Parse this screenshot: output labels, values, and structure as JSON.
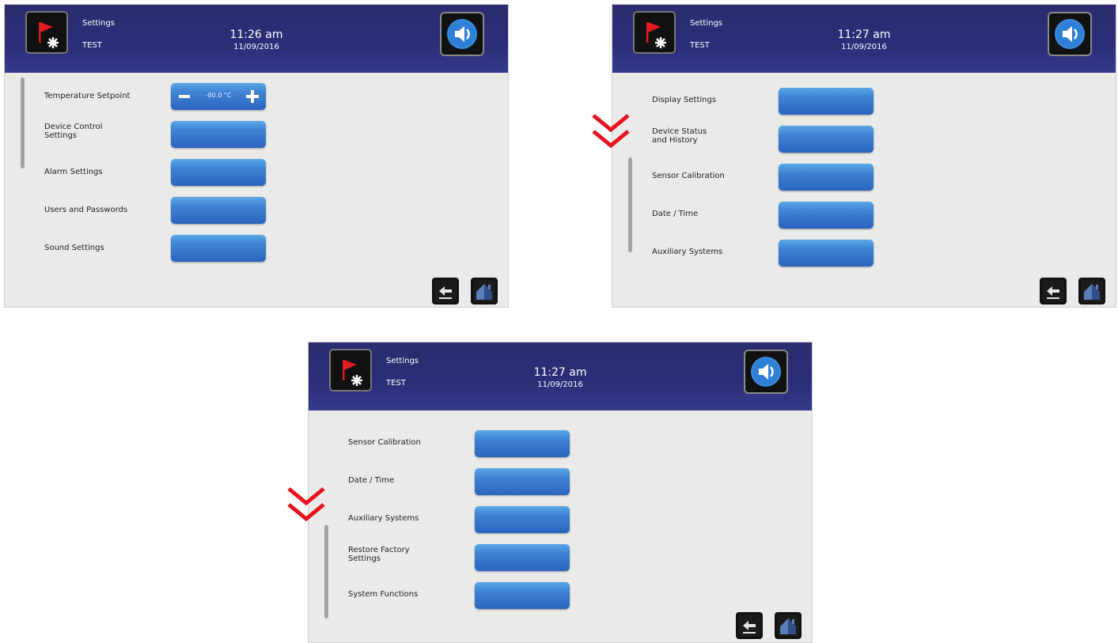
{
  "header": {
    "title": "Settings",
    "subtitle": "TEST",
    "date": "11/09/2016"
  },
  "screens": [
    {
      "time": "11:26 am",
      "setpoint": {
        "label": "Temperature Setpoint",
        "value": "-80.0 °C"
      },
      "items": [
        {
          "label": "Device Control\nSettings"
        },
        {
          "label": "Alarm Settings"
        },
        {
          "label": "Users and Passwords"
        },
        {
          "label": "Sound Settings"
        }
      ]
    },
    {
      "time": "11:27 am",
      "items": [
        {
          "label": "Display Settings"
        },
        {
          "label": "Device Status\nand History"
        },
        {
          "label": "Sensor Calibration"
        },
        {
          "label": "Date / Time"
        },
        {
          "label": "Auxiliary Systems"
        }
      ]
    },
    {
      "time": "11:27 am",
      "items": [
        {
          "label": "Sensor Calibration"
        },
        {
          "label": "Date / Time"
        },
        {
          "label": "Auxiliary Systems"
        },
        {
          "label": "Restore Factory\nSettings"
        },
        {
          "label": "System Functions"
        }
      ]
    }
  ],
  "icons": {
    "alarm": "alarm-flag-icon",
    "sound": "speaker-icon",
    "back": "back-arrow-icon",
    "home": "home-icon",
    "scroll_hint": "double-chevron-down-icon"
  },
  "colors": {
    "header": "#2b2e78",
    "button": "#3f82d3",
    "background": "#eaebe8",
    "flag": "#e01b24",
    "chevron": "#e8121e"
  }
}
